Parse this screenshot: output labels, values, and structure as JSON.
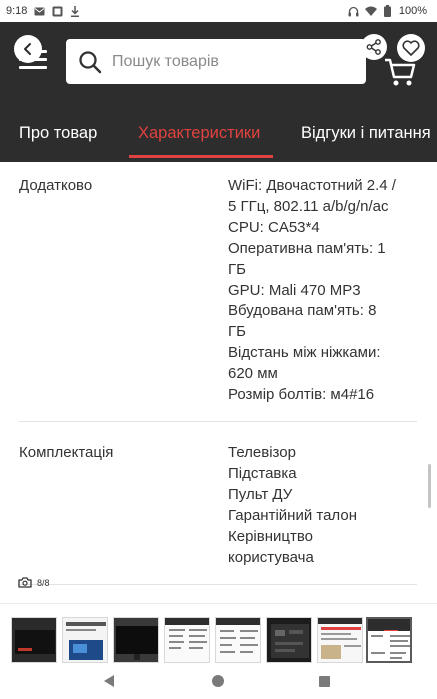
{
  "status_bar": {
    "time": "9:18",
    "battery": "100%"
  },
  "header": {
    "search_placeholder": "Пошук товарів",
    "icons": [
      "back-icon",
      "menu-icon",
      "search-icon",
      "share-icon",
      "heart-icon",
      "cart-icon"
    ]
  },
  "tabs": [
    {
      "label": "Про товар",
      "active": false
    },
    {
      "label": "Характеристики",
      "active": true
    },
    {
      "label": "Відгуки і питання",
      "active": false
    }
  ],
  "specs": [
    {
      "label": "Додатково",
      "lines": [
        "WiFi: Двочастотний 2.4 /",
        "5 ГГц, 802.11 a/b/g/n/ac",
        "CPU: CA53*4",
        "Оперативна пам'ять: 1",
        "ГБ",
        "GPU: Mali 470 MP3",
        "Вбудована пам'ять: 8",
        "ГБ",
        "Відстань між ніжками:",
        "620 мм",
        "Розмір болтів: м4#16"
      ]
    },
    {
      "label": "Комплектація",
      "lines": [
        "Телевізор",
        "Підставка",
        "Пульт ДУ",
        "Гарантійний талон",
        "Керівництво",
        "користувача"
      ]
    }
  ],
  "gallery": {
    "counter": "8/8",
    "thumbnails": [
      "tv-dark",
      "promo-blue",
      "tv-black",
      "spec-sheet",
      "spec-sheet-2",
      "tv-back-panel",
      "article-page",
      "spec-page-active"
    ]
  },
  "colors": {
    "header_bg": "#2d2d2d",
    "accent": "#e0423f",
    "text": "#333333"
  }
}
